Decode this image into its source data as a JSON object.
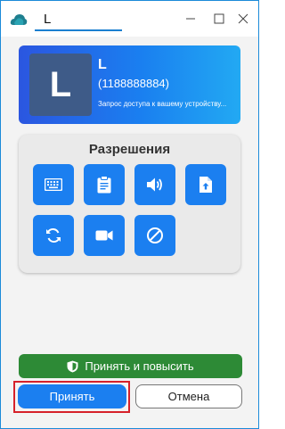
{
  "window": {
    "title": "L"
  },
  "user": {
    "avatar_letter": "L",
    "name": "L",
    "id": "(1188888884)",
    "note": "Запрос доступа к вашему устройству..."
  },
  "permissions": {
    "title": "Разрешения",
    "buttons": [
      {
        "name": "keyboard",
        "icon": "keyboard-icon"
      },
      {
        "name": "clipboard",
        "icon": "clipboard-icon"
      },
      {
        "name": "audio",
        "icon": "speaker-icon"
      },
      {
        "name": "file-transfer",
        "icon": "file-upload-icon"
      },
      {
        "name": "restart",
        "icon": "refresh-icon"
      },
      {
        "name": "recording",
        "icon": "video-camera-icon"
      },
      {
        "name": "block-input",
        "icon": "block-icon"
      }
    ]
  },
  "actions": {
    "accept_elevate_label": "Принять и повысить",
    "accept_label": "Принять",
    "cancel_label": "Отмена"
  },
  "colors": {
    "accent": "#1b7ff0",
    "elevate_green": "#2d8a36",
    "highlight_red": "#d6212a"
  }
}
